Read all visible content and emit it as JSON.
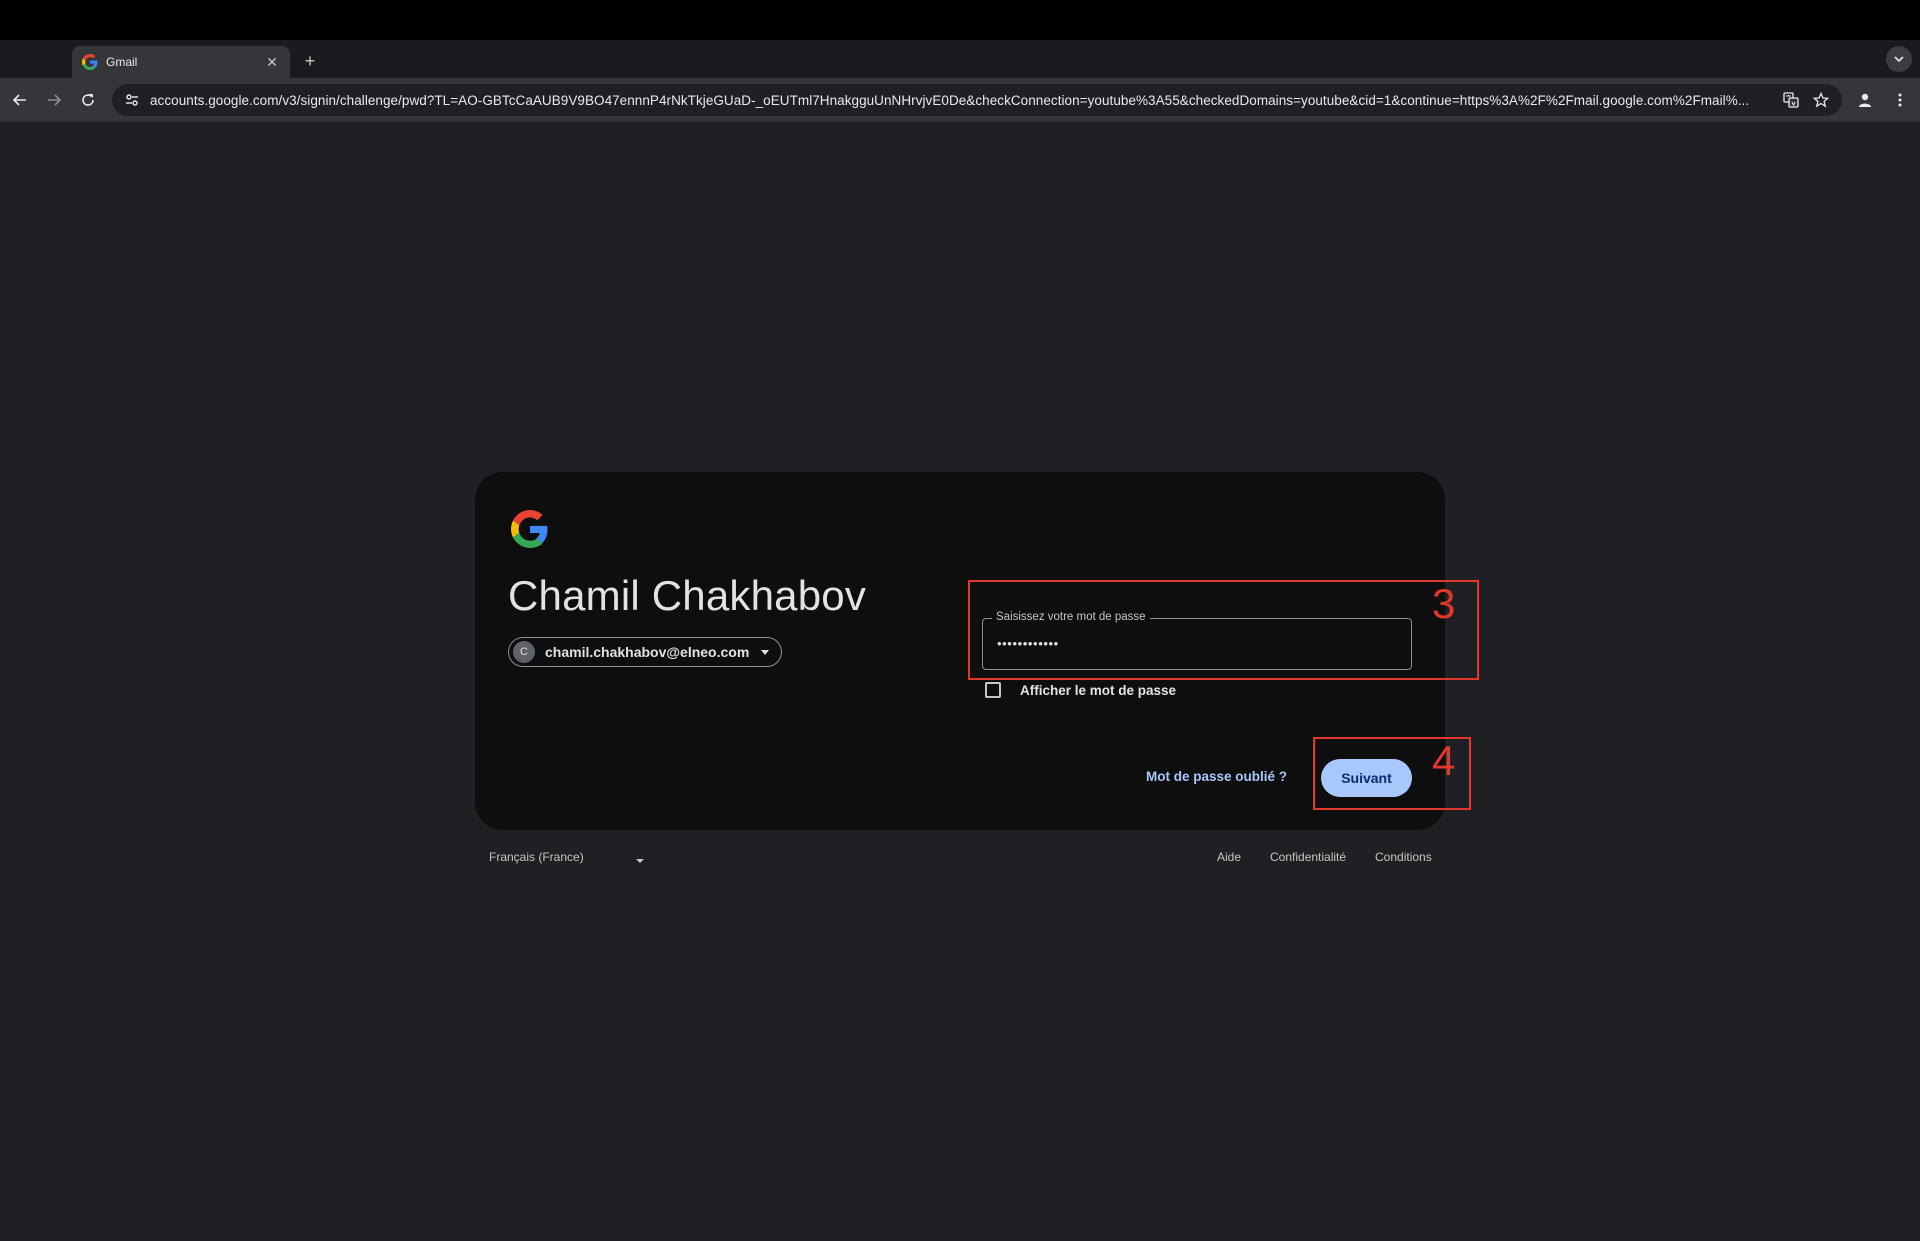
{
  "browser": {
    "tab": {
      "title": "Gmail",
      "close_glyph": "✕"
    },
    "new_tab_glyph": "+",
    "url": "accounts.google.com/v3/signin/challenge/pwd?TL=AO-GBTcCaAUB9V9BO47ennnP4rNkTkjeGUaD-_oEUTml7HnakgguUnNHrvjvE0De&checkConnection=youtube%3A55&checkedDomains=youtube&cid=1&continue=https%3A%2F%2Fmail.google.com%2Fmail%..."
  },
  "signin": {
    "name": "Chamil Chakhabov",
    "account_initial": "C",
    "account_email": "chamil.chakhabov@elneo.com",
    "password_label": "Saisissez votre mot de passe",
    "password_value": "••••••••••••",
    "show_password_label": "Afficher le mot de passe",
    "forgot_label": "Mot de passe oublié ?",
    "next_label": "Suivant"
  },
  "annotations": {
    "password_step": "3",
    "next_step": "4"
  },
  "footer": {
    "language": "Français (France)",
    "help": "Aide",
    "privacy": "Confidentialité",
    "terms": "Conditions"
  },
  "colors": {
    "accent": "#a8c7fa",
    "annotation": "#e2372a",
    "card": "#0e0e0e",
    "page": "#1f2023"
  }
}
